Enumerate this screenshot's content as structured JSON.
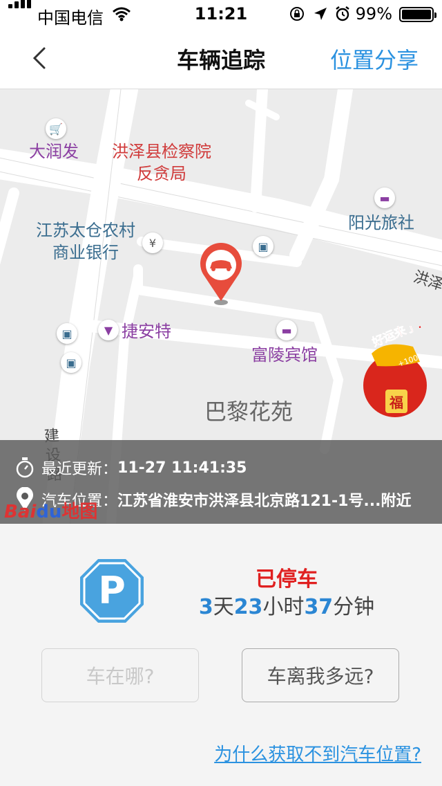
{
  "status_bar": {
    "carrier": "中国电信",
    "time": "11:21",
    "battery_pct": "99%",
    "battery_level": 0.99
  },
  "nav": {
    "back_icon": "chevron-left-icon",
    "title": "车辆追踪",
    "share_label": "位置分享"
  },
  "map": {
    "pois": {
      "darunfa": "大润发",
      "procuratorate_line1": "洪泽县检察院",
      "procuratorate_line2": "反贪局",
      "bank_line1": "江苏太仓农村",
      "bank_line2": "商业银行",
      "hotel_yangguang": "阳光旅社",
      "jieante": "捷安特",
      "hotel_fuling": "富陵宾馆",
      "bali_garden": "巴黎花苑",
      "road_jianshe": "建设路",
      "road_hongze": "洪泽"
    },
    "luck_banner": {
      "text": "好运来了!",
      "badge": "+100",
      "envelope": "福"
    },
    "logo": {
      "brand_a": "Bai",
      "brand_b": "du",
      "brand_c": "地图"
    },
    "info": {
      "update_label": "最近更新：",
      "update_value": "11-27 11:41:35",
      "location_label": "汽车位置：",
      "location_value": "江苏省淮安市洪泽县北京路121-1号...附近"
    }
  },
  "parking": {
    "badge_letter": "P",
    "status": "已停车",
    "days": "3",
    "days_unit": "天",
    "hours": "23",
    "hours_unit": "小时",
    "minutes": "37",
    "minutes_unit": "分钟"
  },
  "actions": {
    "where_car": "车在哪?",
    "how_far": "车离我多远?"
  },
  "help_link": "为什么获取不到汽车位置?",
  "colors": {
    "accent": "#2b92e0",
    "status_red": "#e02020",
    "badge_blue": "#49a3df"
  }
}
